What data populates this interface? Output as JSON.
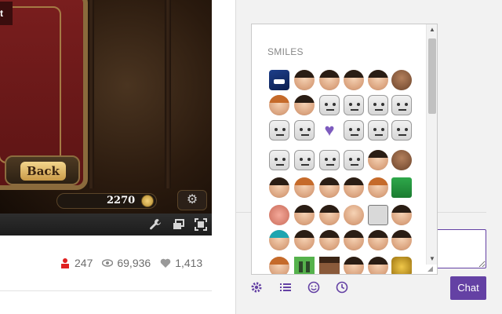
{
  "video": {
    "top_tag": "t",
    "back_button_label": "Back",
    "gold_value": "2270"
  },
  "player_controls": {
    "icons": [
      "wrench-icon",
      "popout-icon",
      "fullscreen-icon"
    ]
  },
  "stats": {
    "viewers": "247",
    "views": "69,936",
    "followers": "1,413"
  },
  "emote_popup": {
    "section_title": "SMILES"
  },
  "chat": {
    "send_label": "Chat",
    "input_value": "",
    "tools": [
      "settings-icon",
      "list-icon",
      "emote-icon",
      "history-icon"
    ]
  },
  "colors": {
    "accent": "#6441a4",
    "viewer_icon": "#e02020"
  }
}
